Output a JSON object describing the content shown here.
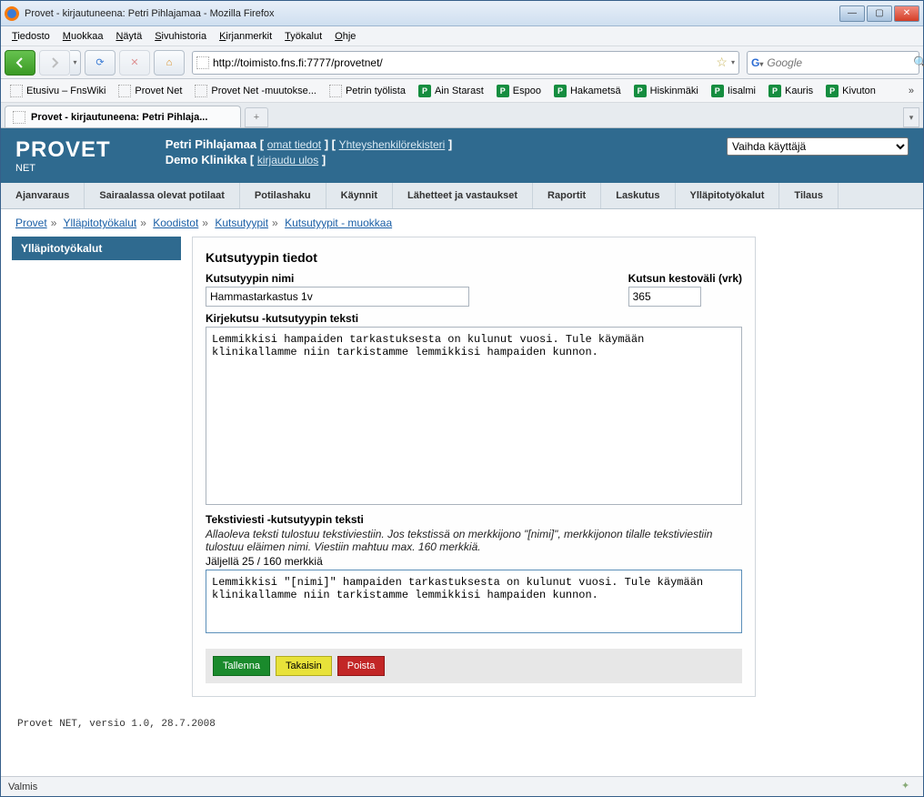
{
  "window": {
    "title": "Provet - kirjautuneena: Petri Pihlajamaa - Mozilla Firefox"
  },
  "menubar": [
    "Tiedosto",
    "Muokkaa",
    "Näytä",
    "Sivuhistoria",
    "Kirjanmerkit",
    "Työkalut",
    "Ohje"
  ],
  "url": "http://toimisto.fns.fi:7777/provetnet/",
  "search_placeholder": "Google",
  "bookmarks": [
    "Etusivu – FnsWiki",
    "Provet Net",
    "Provet Net -muutokse...",
    "Petrin työlista",
    "Ain Starast",
    "Espoo",
    "Hakametsä",
    "Hiskinmäki",
    "Iisalmi",
    "Kauris",
    "Kivuton"
  ],
  "bookmark_p_flags": [
    false,
    false,
    false,
    false,
    true,
    true,
    true,
    true,
    true,
    true,
    true
  ],
  "bm_more": "»",
  "tab": {
    "label": "Provet - kirjautuneena: Petri Pihlaja..."
  },
  "app": {
    "logo": "PROVET",
    "logo_sub": "NET",
    "user_name": "Petri Pihlajamaa",
    "clinic_name": "Demo Klinikka",
    "link_owninfo": "omat tiedot",
    "link_contactreg": "Yhteyshenkilörekisteri",
    "link_logout": "kirjaudu ulos",
    "switch_user_label": "Vaihda käyttäjä"
  },
  "nav_items": [
    "Ajanvaraus",
    "Sairaalassa olevat potilaat",
    "Potilashaku",
    "Käynnit",
    "Lähetteet ja vastaukset",
    "Raportit",
    "Laskutus",
    "Ylläpitotyökalut",
    "Tilaus"
  ],
  "breadcrumb": {
    "items": [
      "Provet",
      "Ylläpitotyökalut",
      "Koodistot",
      "Kutsutyypit",
      "Kutsutyypit - muokkaa"
    ]
  },
  "sidebar": {
    "title": "Ylläpitotyökalut"
  },
  "form": {
    "heading": "Kutsutyypin tiedot",
    "name_label": "Kutsutyypin nimi",
    "name_value": "Hammastarkastus 1v",
    "interval_label": "Kutsun kestoväli (vrk)",
    "interval_value": "365",
    "letter_label": "Kirjekutsu -kutsutyypin teksti",
    "letter_text": "Lemmikkisi hampaiden tarkastuksesta on kulunut vuosi. Tule käymään klinikallamme niin tarkistamme lemmikkisi hampaiden kunnon.",
    "sms_label": "Tekstiviesti -kutsutyypin teksti",
    "sms_hint": "Allaoleva teksti tulostuu tekstiviestiin. Jos tekstissä on merkkijono \"[nimi]\", merkkijonon tilalle tekstiviestiin tulostuu eläimen nimi. Viestiin mahtuu max. 160 merkkiä.",
    "sms_counter_prefix": "Jäljellä ",
    "sms_counter_value": "25",
    "sms_counter_suffix": " / 160 merkkiä",
    "sms_text": "Lemmikkisi \"[nimi]\" hampaiden tarkastuksesta on kulunut vuosi. Tule käymään klinikallamme niin tarkistamme lemmikkisi hampaiden kunnon.",
    "btn_save": "Tallenna",
    "btn_back": "Takaisin",
    "btn_delete": "Poista"
  },
  "footer_version": "Provet NET, versio 1.0, 28.7.2008",
  "status": "Valmis"
}
